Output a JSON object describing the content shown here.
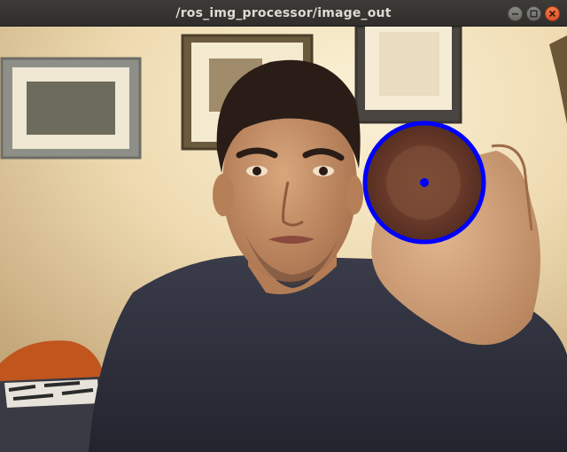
{
  "window": {
    "title": "/ros_img_processor/image_out"
  },
  "controls": {
    "minimize_icon": "minimize-icon",
    "maximize_icon": "maximize-icon",
    "close_icon": "close-icon"
  },
  "image": {
    "scene": "webcam frame of a person holding a cup toward the camera",
    "detection_circle_color": "#0000ff",
    "detection_center_color": "#0000ff"
  }
}
